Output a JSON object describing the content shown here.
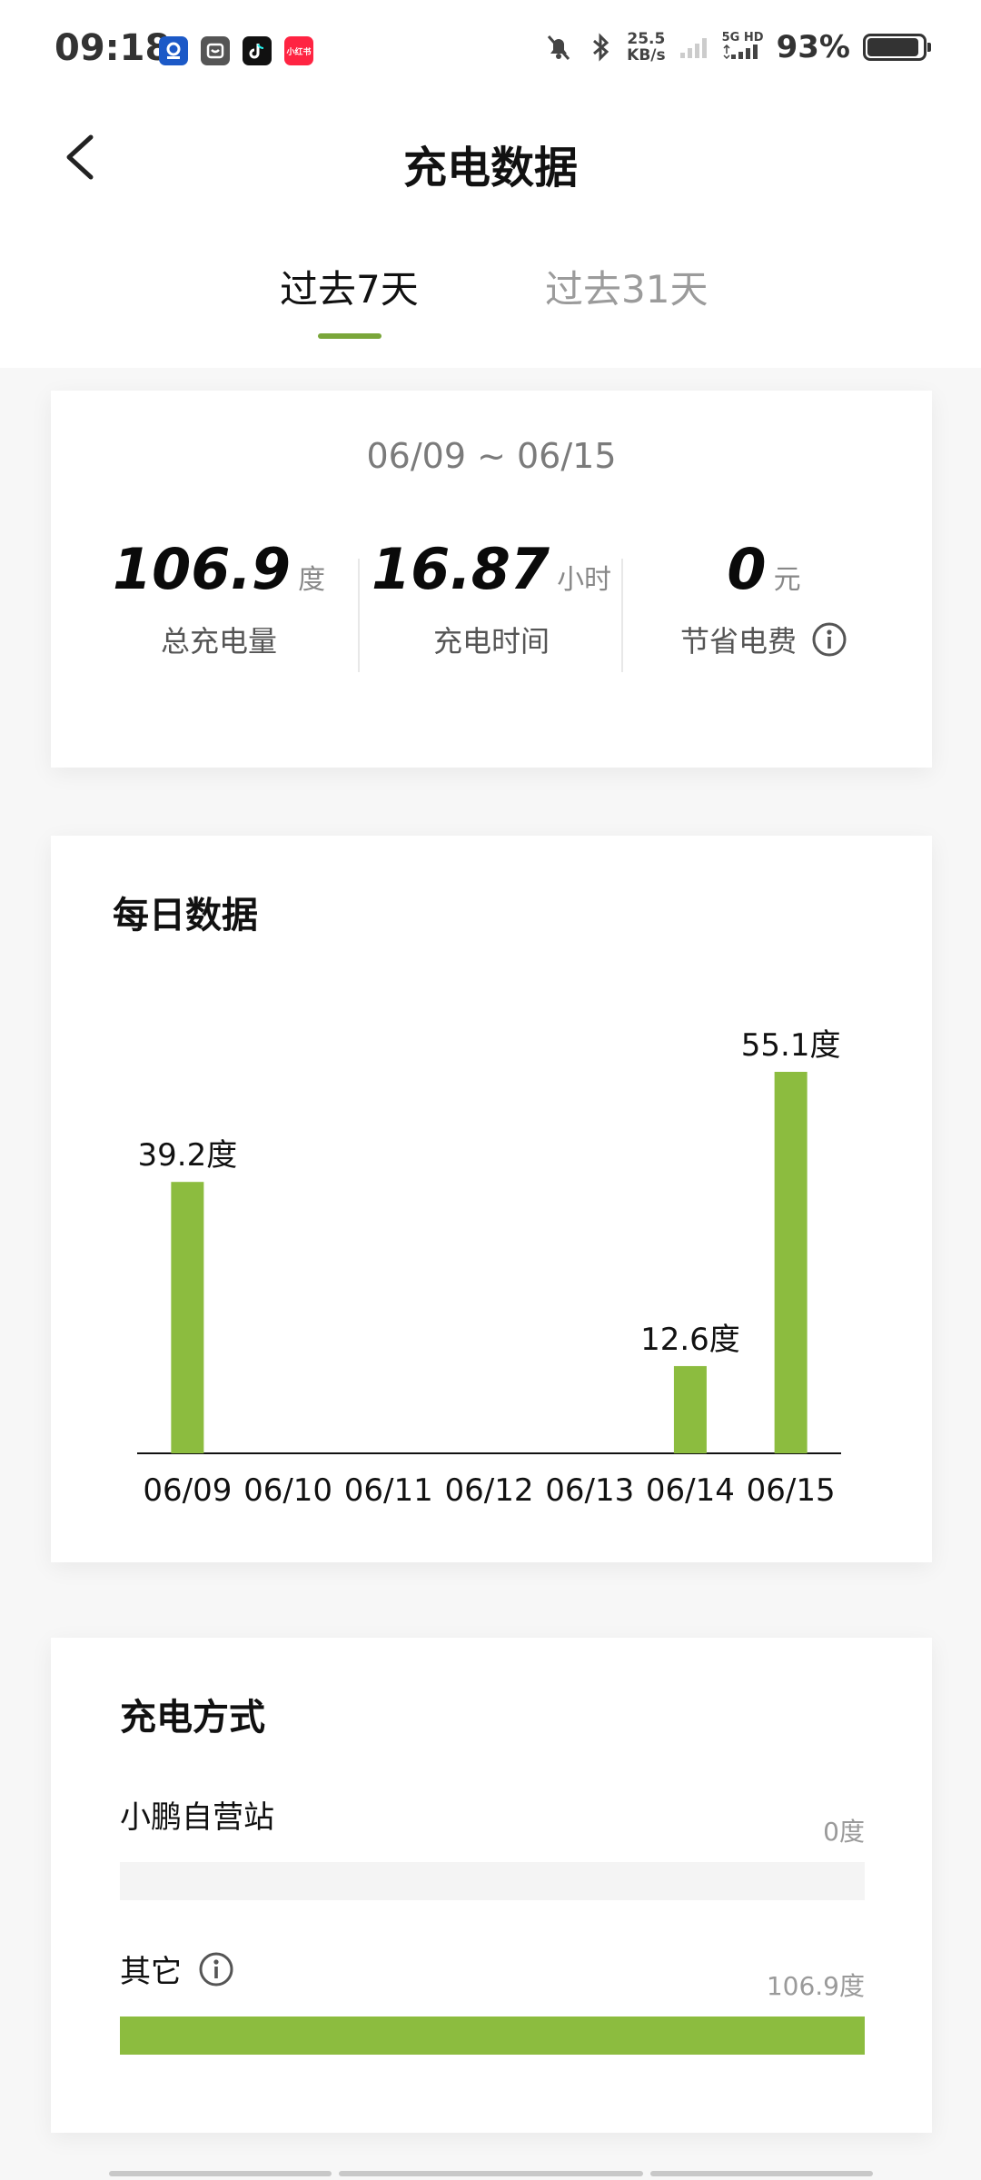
{
  "status_bar": {
    "time": "09:18",
    "network_speed_value": "25.5",
    "network_speed_unit": "KB/s",
    "network_label": "5G HD",
    "battery_text": "93%",
    "battery_level": 0.93,
    "app_icons": [
      "app-icon-1",
      "app-icon-2",
      "douyin-icon",
      "xiaohongshu-icon"
    ],
    "xiaohongshu_label": "小红书"
  },
  "header": {
    "title": "充电数据"
  },
  "tabs": [
    {
      "label": "过去7天",
      "active": true
    },
    {
      "label": "过去31天",
      "active": false
    }
  ],
  "summary": {
    "date_range": "06/09 ~ 06/15",
    "stats": [
      {
        "value": "106.9",
        "unit": "度",
        "label": "总充电量"
      },
      {
        "value": "16.87",
        "unit": "小时",
        "label": "充电时间"
      },
      {
        "value": "0",
        "unit": "元",
        "label": "节省电费"
      }
    ]
  },
  "daily": {
    "title": "每日数据"
  },
  "chart_data": {
    "type": "bar",
    "categories": [
      "06/09",
      "06/10",
      "06/11",
      "06/12",
      "06/13",
      "06/14",
      "06/15"
    ],
    "values": [
      39.2,
      0,
      0,
      0,
      0,
      12.6,
      55.1
    ],
    "data_labels": [
      "39.2度",
      "",
      "",
      "",
      "",
      "12.6度",
      "55.1度"
    ],
    "unit": "度",
    "bar_color": "#8cbc3f",
    "grid": false
  },
  "methods": {
    "title": "充电方式",
    "items": [
      {
        "name": "小鹏自营站",
        "value": "0度",
        "fraction": 0,
        "has_info": false
      },
      {
        "name": "其它",
        "value": "106.9度",
        "fraction": 1,
        "has_info": true
      }
    ]
  },
  "colors": {
    "accent": "#7aa63a",
    "bar": "#8cbc3f"
  }
}
